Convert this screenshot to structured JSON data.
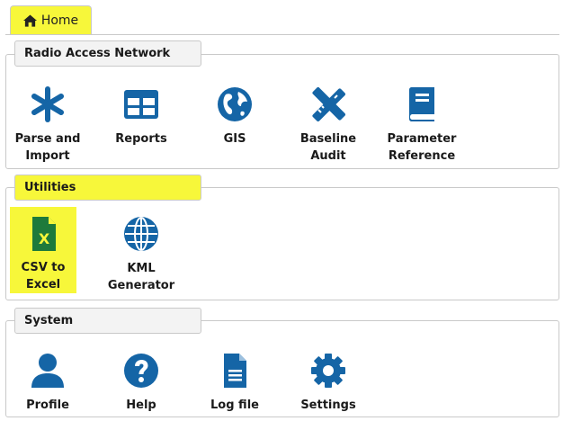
{
  "colors": {
    "icon": "#1565a6",
    "highlight": "#f7f73a",
    "border": "#c9c9c9"
  },
  "tabs": {
    "home": {
      "label": "Home",
      "icon": "home-icon"
    }
  },
  "sections": {
    "ran": {
      "title": "Radio Access Network",
      "items": [
        {
          "label": "Parse and\nImport",
          "icon": "asterisk-icon"
        },
        {
          "label": "Reports",
          "icon": "table-icon"
        },
        {
          "label": "GIS",
          "icon": "globe-americas-icon"
        },
        {
          "label": "Baseline\nAudit",
          "icon": "pencil-ruler-icon"
        },
        {
          "label": "Parameter\nReference",
          "icon": "book-icon"
        }
      ]
    },
    "utilities": {
      "title": "Utilities",
      "items": [
        {
          "label": "CSV to\nExcel",
          "icon": "excel-file-icon"
        },
        {
          "label": "KML\nGenerator",
          "icon": "globe-grid-icon"
        }
      ]
    },
    "system": {
      "title": "System",
      "items": [
        {
          "label": "Profile",
          "icon": "user-icon"
        },
        {
          "label": "Help",
          "icon": "question-circle-icon"
        },
        {
          "label": "Log file",
          "icon": "file-text-icon"
        },
        {
          "label": "Settings",
          "icon": "gear-icon"
        }
      ]
    }
  }
}
